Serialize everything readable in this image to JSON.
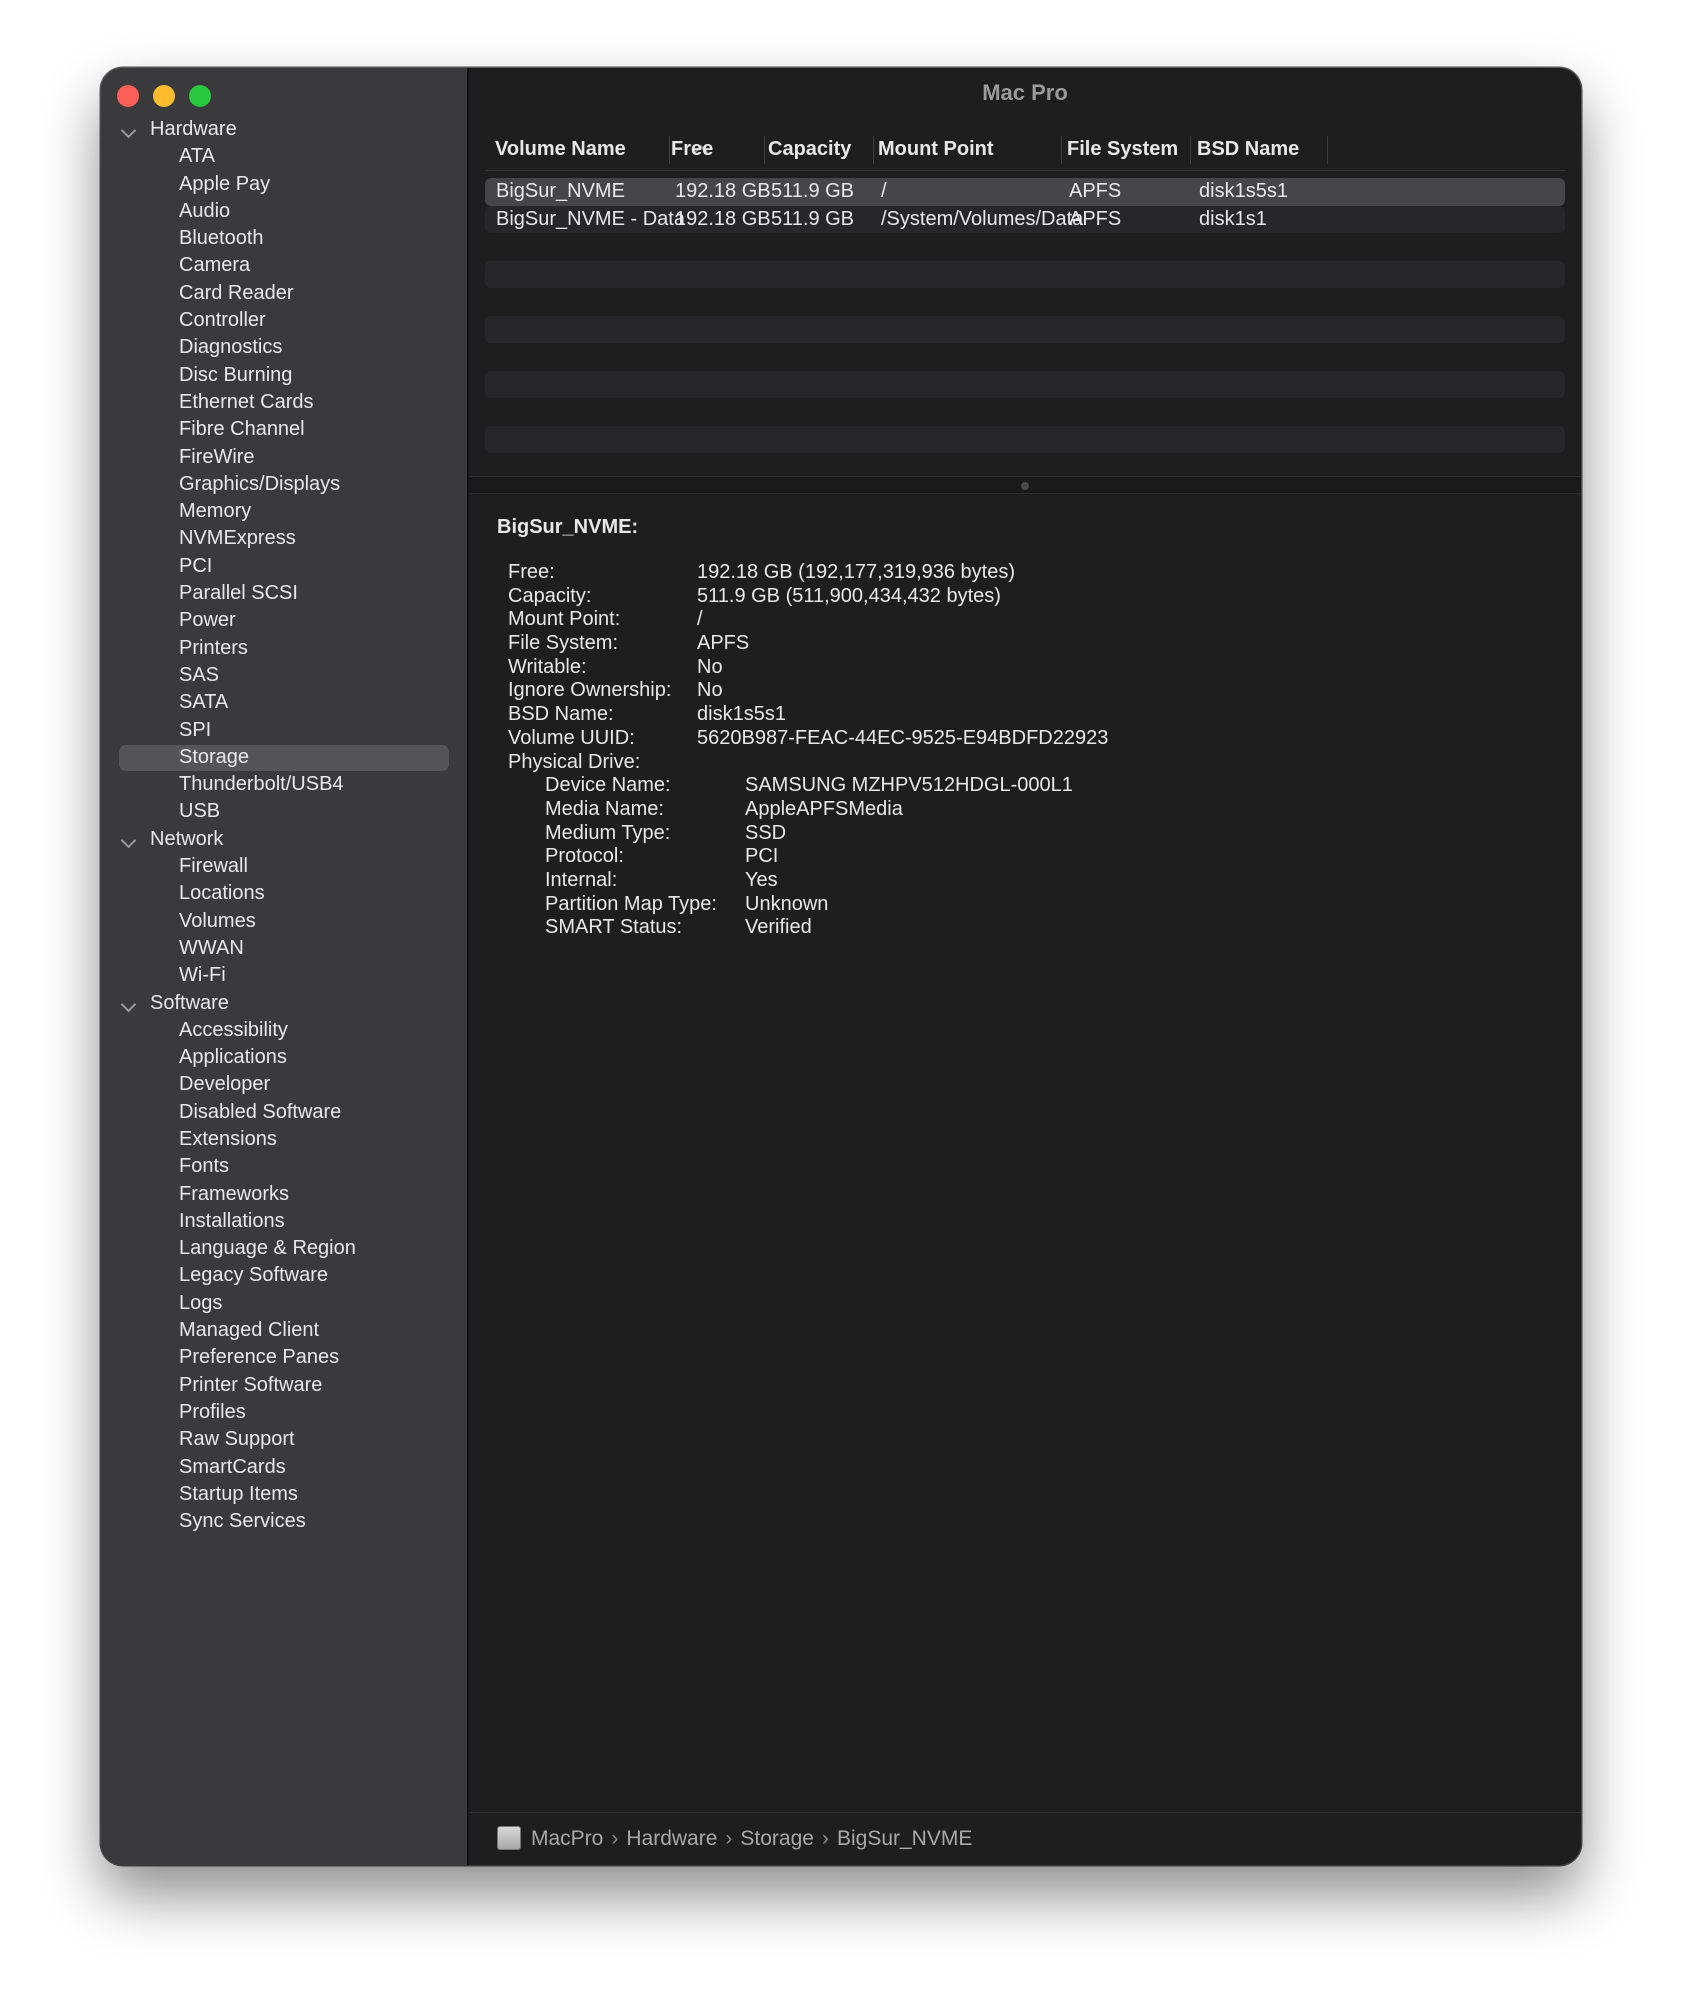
{
  "window": {
    "title": "Mac Pro"
  },
  "sidebar": {
    "groups": [
      {
        "label": "Hardware",
        "items": [
          "ATA",
          "Apple Pay",
          "Audio",
          "Bluetooth",
          "Camera",
          "Card Reader",
          "Controller",
          "Diagnostics",
          "Disc Burning",
          "Ethernet Cards",
          "Fibre Channel",
          "FireWire",
          "Graphics/Displays",
          "Memory",
          "NVMExpress",
          "PCI",
          "Parallel SCSI",
          "Power",
          "Printers",
          "SAS",
          "SATA",
          "SPI",
          "Storage",
          "Thunderbolt/USB4",
          "USB"
        ]
      },
      {
        "label": "Network",
        "items": [
          "Firewall",
          "Locations",
          "Volumes",
          "WWAN",
          "Wi-Fi"
        ]
      },
      {
        "label": "Software",
        "items": [
          "Accessibility",
          "Applications",
          "Developer",
          "Disabled Software",
          "Extensions",
          "Fonts",
          "Frameworks",
          "Installations",
          "Language & Region",
          "Legacy Software",
          "Logs",
          "Managed Client",
          "Preference Panes",
          "Printer Software",
          "Profiles",
          "Raw Support",
          "SmartCards",
          "Startup Items",
          "Sync Services"
        ]
      }
    ],
    "selected": "Storage"
  },
  "table": {
    "columns": [
      "Volume Name",
      "Free",
      "Capacity",
      "Mount Point",
      "File System",
      "BSD Name"
    ],
    "rows": [
      [
        "BigSur_NVME",
        "192.18 GB",
        "511.9 GB",
        "/",
        "APFS",
        "disk1s5s1"
      ],
      [
        "BigSur_NVME - Data",
        "192.18 GB",
        "511.9 GB",
        "/System/Volumes/Data",
        "APFS",
        "disk1s1"
      ]
    ]
  },
  "detail": {
    "title": "BigSur_NVME:",
    "fields": [
      {
        "k": "Free:",
        "v": "192.18 GB (192,177,319,936 bytes)"
      },
      {
        "k": "Capacity:",
        "v": "511.9 GB (511,900,434,432 bytes)"
      },
      {
        "k": "Mount Point:",
        "v": "/"
      },
      {
        "k": "File System:",
        "v": "APFS"
      },
      {
        "k": "Writable:",
        "v": "No"
      },
      {
        "k": "Ignore Ownership:",
        "v": "No"
      },
      {
        "k": "BSD Name:",
        "v": "disk1s5s1"
      },
      {
        "k": "Volume UUID:",
        "v": "5620B987-FEAC-44EC-9525-E94BDFD22923"
      },
      {
        "k": "Physical Drive:",
        "v": ""
      }
    ],
    "physical_drive": [
      {
        "k": "Device Name:",
        "v": "SAMSUNG MZHPV512HDGL-000L1"
      },
      {
        "k": "Media Name:",
        "v": "AppleAPFSMedia"
      },
      {
        "k": "Medium Type:",
        "v": "SSD"
      },
      {
        "k": "Protocol:",
        "v": "PCI"
      },
      {
        "k": "Internal:",
        "v": "Yes"
      },
      {
        "k": "Partition Map Type:",
        "v": "Unknown"
      },
      {
        "k": "SMART Status:",
        "v": "Verified"
      }
    ]
  },
  "breadcrumb": [
    "MacPro",
    "Hardware",
    "Storage",
    "BigSur_NVME"
  ],
  "colors": {
    "close": "#ff5f57",
    "minimize": "#febc2e",
    "zoom": "#28c840"
  }
}
